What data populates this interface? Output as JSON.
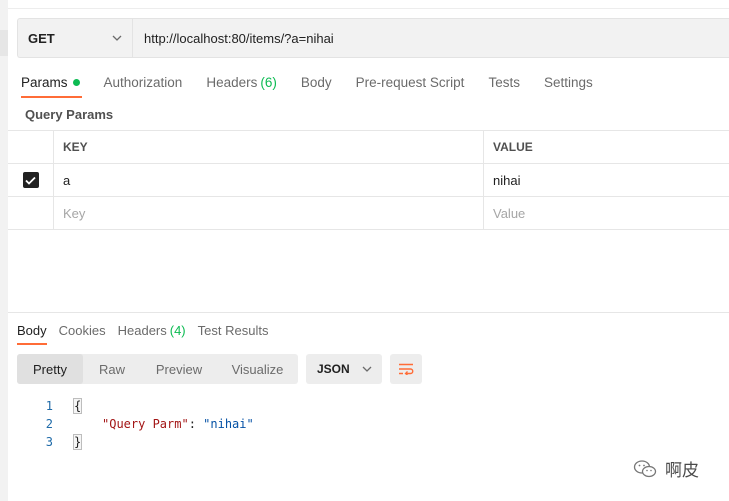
{
  "request": {
    "method": "GET",
    "url": "http://localhost:80/items/?a=nihai"
  },
  "request_tabs": [
    {
      "label": "Params",
      "active": true
    },
    {
      "label": "Authorization"
    },
    {
      "label": "Headers",
      "count": "(6)"
    },
    {
      "label": "Body"
    },
    {
      "label": "Pre-request Script"
    },
    {
      "label": "Tests"
    },
    {
      "label": "Settings"
    }
  ],
  "query_params": {
    "title": "Query Params",
    "headers": {
      "key": "KEY",
      "value": "VALUE"
    },
    "rows": [
      {
        "key": "a",
        "value": "nihai",
        "checked": true
      }
    ],
    "placeholder": {
      "key": "Key",
      "value": "Value"
    }
  },
  "response_tabs": [
    {
      "label": "Body",
      "active": true
    },
    {
      "label": "Cookies"
    },
    {
      "label": "Headers",
      "count": "(4)"
    },
    {
      "label": "Test Results"
    }
  ],
  "view_modes": [
    "Pretty",
    "Raw",
    "Preview",
    "Visualize"
  ],
  "format": "JSON",
  "code": {
    "line_numbers": [
      "1",
      "2",
      "3"
    ],
    "open": "{",
    "key": "\"Query Parm\"",
    "colon": ": ",
    "value": "\"nihai\"",
    "close": "}"
  },
  "watermark": "啊皮",
  "colors": {
    "accent": "#ff6c37",
    "green": "#0cbb52"
  }
}
